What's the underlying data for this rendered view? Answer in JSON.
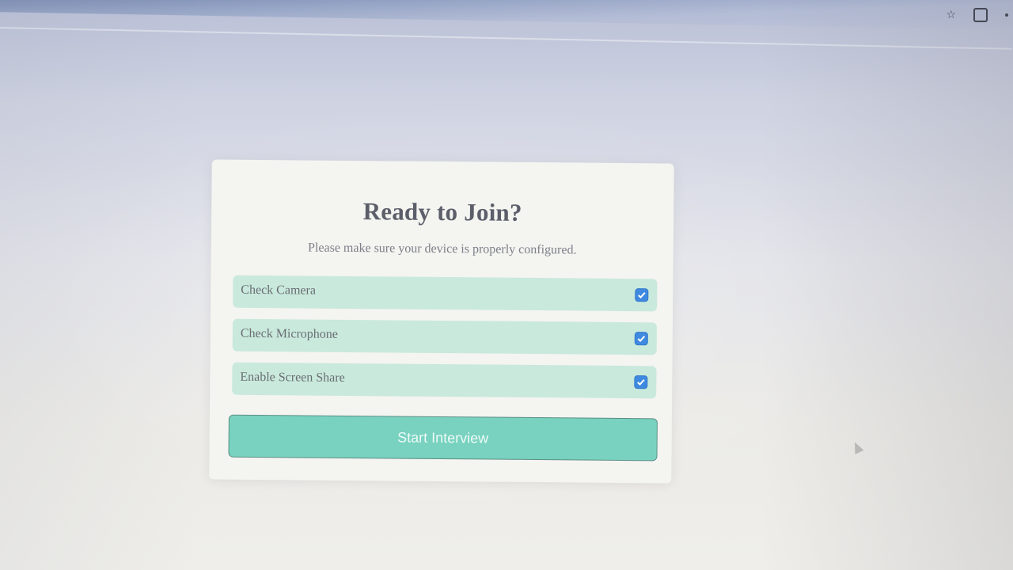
{
  "dialog": {
    "title": "Ready to Join?",
    "subtitle": "Please make sure your device is properly configured.",
    "checks": [
      {
        "label": "Check Camera",
        "checked": true
      },
      {
        "label": "Check Microphone",
        "checked": true
      },
      {
        "label": "Enable Screen Share",
        "checked": true
      }
    ],
    "start_button_label": "Start Interview"
  },
  "colors": {
    "check_row_bg": "#c9e9dc",
    "checkbox_accent": "#3f8ae0",
    "button_bg": "#78d2bf",
    "title_text": "#5c5f6a"
  },
  "browser": {
    "icons": [
      "bookmark-star-icon",
      "extensions-icon",
      "more-menu-icon"
    ]
  }
}
